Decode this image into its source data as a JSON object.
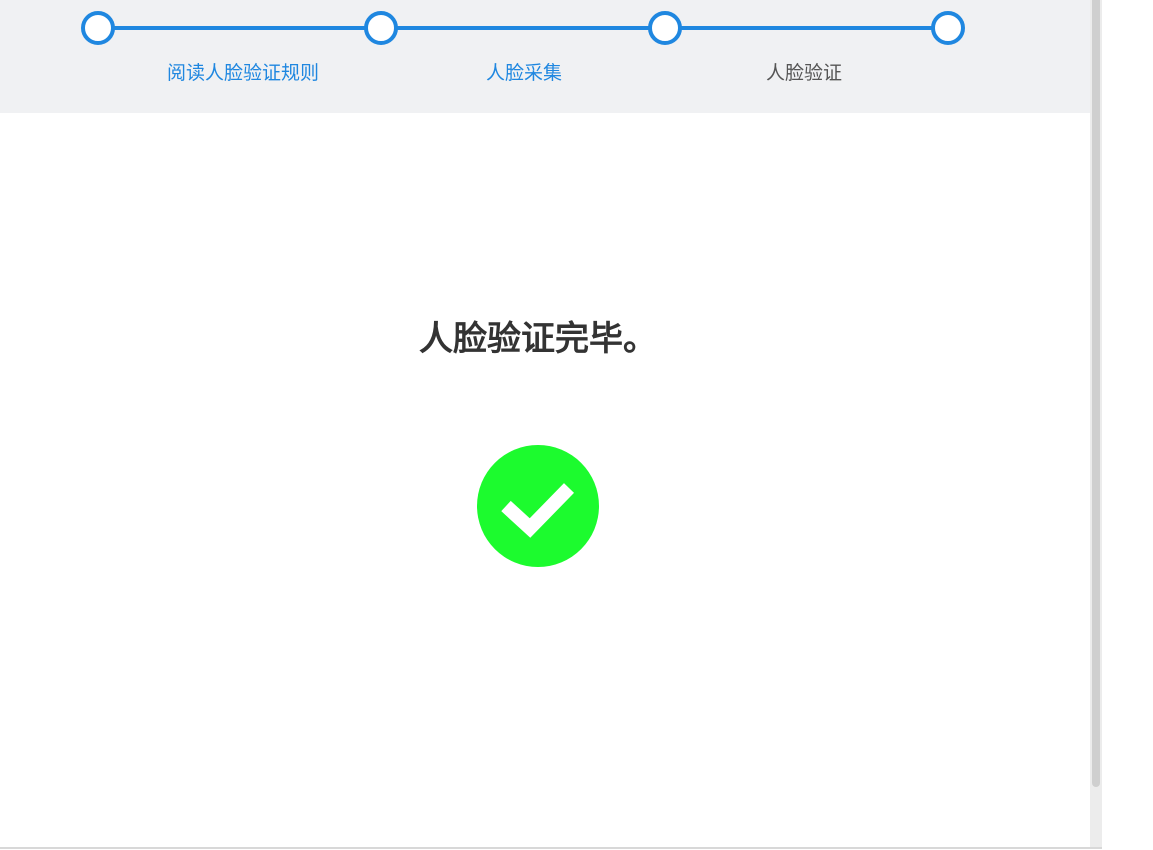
{
  "progress": {
    "steps": [
      {
        "label": "阅读人脸验证规则",
        "state": "done"
      },
      {
        "label": "人脸采集",
        "state": "done"
      },
      {
        "label": "人脸验证",
        "state": "current"
      }
    ],
    "color": "#1f87e0"
  },
  "result": {
    "title": "人脸验证完毕。",
    "icon": "check-circle-icon",
    "icon_color": "#1cfb2e"
  }
}
